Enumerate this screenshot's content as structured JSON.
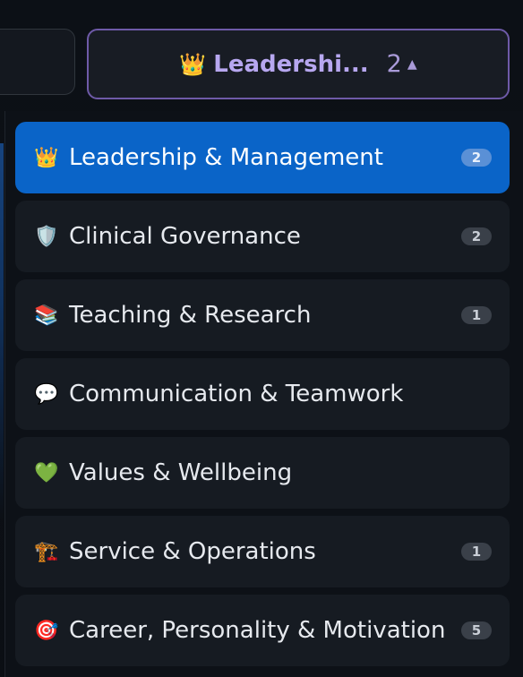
{
  "trigger": {
    "emoji": "👑",
    "label": "Leadershi...",
    "count": "2",
    "caret_icon": "caret-up-icon"
  },
  "menu": {
    "items": [
      {
        "emoji": "👑",
        "label": "Leadership & Management",
        "count": "2",
        "active": true
      },
      {
        "emoji": "🛡️",
        "label": "Clinical Governance",
        "count": "2",
        "active": false
      },
      {
        "emoji": "📚",
        "label": "Teaching & Research",
        "count": "1",
        "active": false
      },
      {
        "emoji": "💬",
        "label": "Communication & Teamwork",
        "count": "",
        "active": false
      },
      {
        "emoji": "💚",
        "label": "Values & Wellbeing",
        "count": "",
        "active": false
      },
      {
        "emoji": "🏗️",
        "label": "Service & Operations",
        "count": "1",
        "active": false
      },
      {
        "emoji": "🎯",
        "label": "Career, Personality & Motivation",
        "count": "5",
        "active": false
      }
    ]
  },
  "colors": {
    "active_item": "#0a64c8",
    "trigger_border": "#6e5aa8",
    "trigger_text": "#b7a7f0",
    "item_background": "#161b22",
    "badge_background": "#3a4049"
  }
}
